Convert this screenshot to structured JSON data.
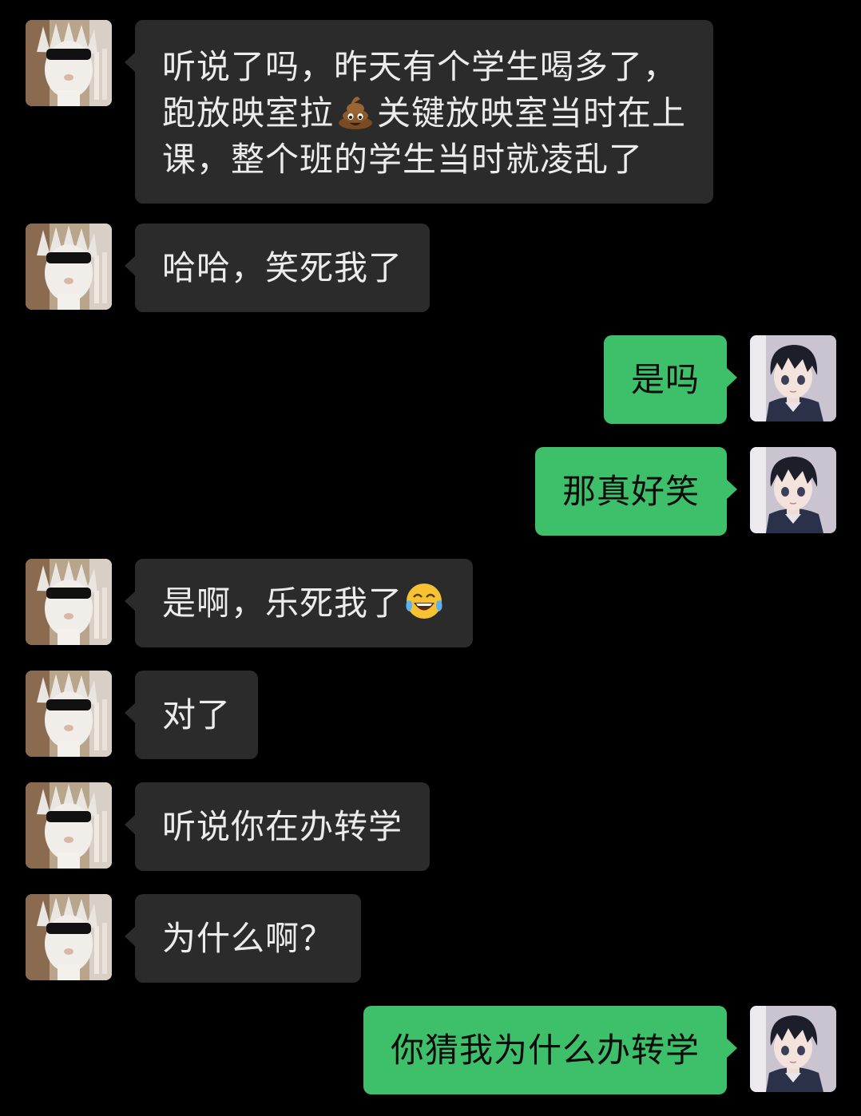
{
  "chat": {
    "messages": [
      {
        "side": "in",
        "lines": [
          "听说了吗，昨天有个学生喝多了，",
          "跑放映室拉",
          "关键放映室当时在上",
          "课，整个班的学生当时就凌乱了"
        ],
        "emoji": "poop-emoji"
      },
      {
        "side": "in",
        "text": "哈哈，笑死我了"
      },
      {
        "side": "out",
        "text": "是吗"
      },
      {
        "side": "out",
        "text": "那真好笑"
      },
      {
        "side": "in",
        "text": "是啊，乐死我了",
        "emoji": "tears-of-joy-emoji"
      },
      {
        "side": "in",
        "text": "对了"
      },
      {
        "side": "in",
        "text": "听说你在办转学"
      },
      {
        "side": "in",
        "text": "为什么啊？"
      },
      {
        "side": "out",
        "text": "你猜我为什么办转学"
      }
    ]
  },
  "colors": {
    "background": "#000000",
    "incoming_bubble": "#2b2b2b",
    "outgoing_bubble": "#3ebf6a",
    "incoming_text": "#ececec",
    "outgoing_text": "#0b0b0b"
  },
  "avatars": {
    "contact": "white-haired-cat-with-sunglasses-avatar",
    "self": "anime-boy-avatar"
  }
}
